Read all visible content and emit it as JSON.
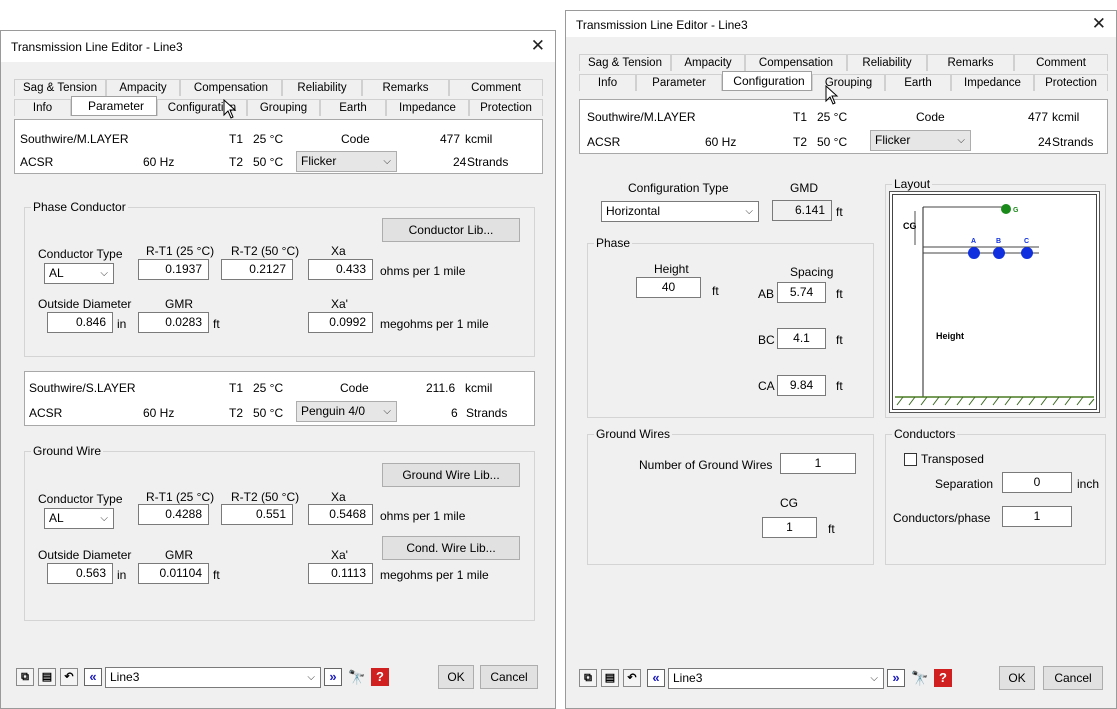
{
  "left": {
    "title": "Transmission Line Editor - Line3",
    "tabs_top": [
      "Sag & Tension",
      "Ampacity",
      "Compensation",
      "Reliability",
      "Remarks",
      "Comment"
    ],
    "tabs_bottom": [
      "Info",
      "Parameter",
      "Configuration",
      "Grouping",
      "Earth",
      "Impedance",
      "Protection"
    ],
    "active_tab": "Parameter",
    "phase_header": {
      "name": "Southwire/M.LAYER",
      "t1_label": "T1",
      "t1": "25 °C",
      "code_label": "Code",
      "size": "477",
      "size_unit": "kcmil",
      "type": "ACSR",
      "freq": "60 Hz",
      "t2_label": "T2",
      "t2": "50 °C",
      "code": "Flicker",
      "strands": "24",
      "strands_label": "Strands"
    },
    "phase_conductor": {
      "caption": "Phase Conductor",
      "lib_button": "Conductor Lib...",
      "col_type": "Conductor Type",
      "col_rt1": "R-T1 (25 °C)",
      "col_rt2": "R-T2 (50 °C)",
      "col_xa": "Xa",
      "type": "AL",
      "rt1": "0.1937",
      "rt2": "0.2127",
      "xa": "0.433",
      "ohms_label": "ohms per 1 mile",
      "col_od": "Outside Diameter",
      "col_gmr": "GMR",
      "col_xap": "Xa'",
      "od": "0.846",
      "od_unit": "in",
      "gmr": "0.0283",
      "gmr_unit": "ft",
      "xap": "0.0992",
      "megohms_label": "megohms per 1 mile"
    },
    "ground_header": {
      "name": "Southwire/S.LAYER",
      "t1_label": "T1",
      "t1": "25 °C",
      "code_label": "Code",
      "size": "211.6",
      "size_unit": "kcmil",
      "type": "ACSR",
      "freq": "60 Hz",
      "t2_label": "T2",
      "t2": "50 °C",
      "code": "Penguin 4/0",
      "strands": "6",
      "strands_label": "Strands"
    },
    "ground_wire": {
      "caption": "Ground Wire",
      "lib_button": "Ground Wire Lib...",
      "cond_button": "Cond. Wire Lib...",
      "col_type": "Conductor Type",
      "col_rt1": "R-T1 (25 °C)",
      "col_rt2": "R-T2 (50 °C)",
      "col_xa": "Xa",
      "type": "AL",
      "rt1": "0.4288",
      "rt2": "0.551",
      "xa": "0.5468",
      "ohms_label": "ohms per 1 mile",
      "col_od": "Outside Diameter",
      "col_gmr": "GMR",
      "col_xap": "Xa'",
      "od": "0.563",
      "od_unit": "in",
      "gmr": "0.01104",
      "gmr_unit": "ft",
      "xap": "0.1113",
      "megohms_label": "megohms per 1 mile"
    },
    "footer": {
      "record": "Line3",
      "ok": "OK",
      "cancel": "Cancel"
    }
  },
  "right": {
    "title": "Transmission Line Editor - Line3",
    "tabs_top": [
      "Sag & Tension",
      "Ampacity",
      "Compensation",
      "Reliability",
      "Remarks",
      "Comment"
    ],
    "tabs_bottom": [
      "Info",
      "Parameter",
      "Configuration",
      "Grouping",
      "Earth",
      "Impedance",
      "Protection"
    ],
    "active_tab": "Configuration",
    "header": {
      "name": "Southwire/M.LAYER",
      "t1_label": "T1",
      "t1": "25 °C",
      "code_label": "Code",
      "size": "477",
      "size_unit": "kcmil",
      "type": "ACSR",
      "freq": "60 Hz",
      "t2_label": "T2",
      "t2": "50 °C",
      "code": "Flicker",
      "strands": "24",
      "strands_label": "Strands"
    },
    "config": {
      "type_label": "Configuration Type",
      "type": "Horizontal",
      "gmd_label": "GMD",
      "gmd": "6.141",
      "gmd_unit": "ft"
    },
    "phase": {
      "caption": "Phase",
      "height_label": "Height",
      "height": "40",
      "height_unit": "ft",
      "spacing_label": "Spacing",
      "ab_label": "AB",
      "ab": "5.74",
      "bc_label": "BC",
      "bc": "4.1",
      "ca_label": "CA",
      "ca": "9.84",
      "unit": "ft"
    },
    "layout": {
      "caption": "Layout",
      "g_label": "G",
      "cg_label": "CG",
      "a_label": "A",
      "b_label": "B",
      "c_label": "C",
      "height_label": "Height",
      "ground_color": "#1a8a1a",
      "phase_color": "#1030e0"
    },
    "ground_wires": {
      "caption": "Ground Wires",
      "num_label": "Number of Ground Wires",
      "num": "1",
      "cg_label": "CG",
      "cg": "1",
      "cg_unit": "ft"
    },
    "conductors": {
      "caption": "Conductors",
      "transposed_label": "Transposed",
      "separation_label": "Separation",
      "separation": "0",
      "separation_unit": "inch",
      "per_phase_label": "Conductors/phase",
      "per_phase": "1"
    },
    "footer": {
      "record": "Line3",
      "ok": "OK",
      "cancel": "Cancel"
    }
  }
}
